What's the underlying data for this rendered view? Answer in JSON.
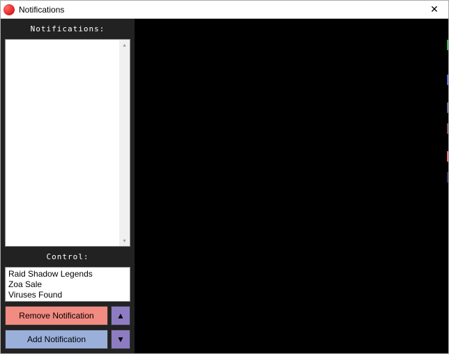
{
  "window": {
    "title": "Notifications",
    "icon_glyph": "",
    "close_glyph": "✕"
  },
  "sections": {
    "notifications_label": "Notifications:",
    "control_label": "Control:"
  },
  "control_list": [
    "Raid Shadow Legends",
    "Zoa Sale",
    "Viruses Found"
  ],
  "buttons": {
    "remove_label": "Remove Notification",
    "add_label": "Add Notification",
    "up_glyph": "▲",
    "down_glyph": "▼"
  },
  "scrollbar": {
    "up_glyph": "▴",
    "down_glyph": "▾"
  }
}
